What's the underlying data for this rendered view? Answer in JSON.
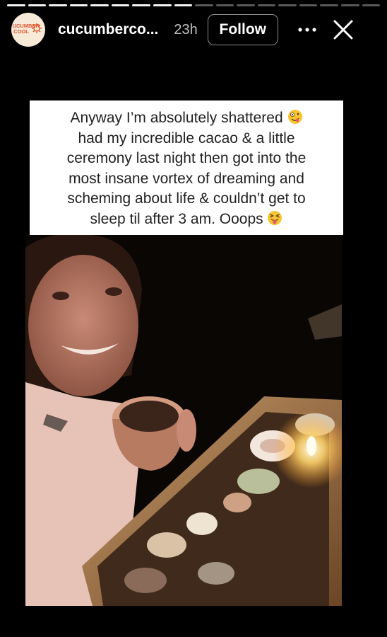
{
  "story": {
    "progress": {
      "segments": 18,
      "completed": 9
    }
  },
  "header": {
    "avatar_text": "CUCUMBER COOL",
    "username": "cucumberco...",
    "time": "23h",
    "follow_label": "Follow",
    "more_icon": "more-horizontal-icon",
    "close_icon": "close-icon"
  },
  "caption": {
    "lines": [
      "Anyway I’m absolutely shattered",
      "had my incredible cacao & a little",
      "ceremony last night then got into the",
      "most insane vortex of dreaming and",
      "scheming about life & couldn’t get to",
      "sleep til after 3 am. Ooops"
    ],
    "emoji_1": "zany-face-emoji",
    "emoji_2": "squinting-tongue-face-emoji"
  },
  "colors": {
    "brand": "#e0542b",
    "avatar_bg": "#f7ead9",
    "background": "#000000"
  }
}
